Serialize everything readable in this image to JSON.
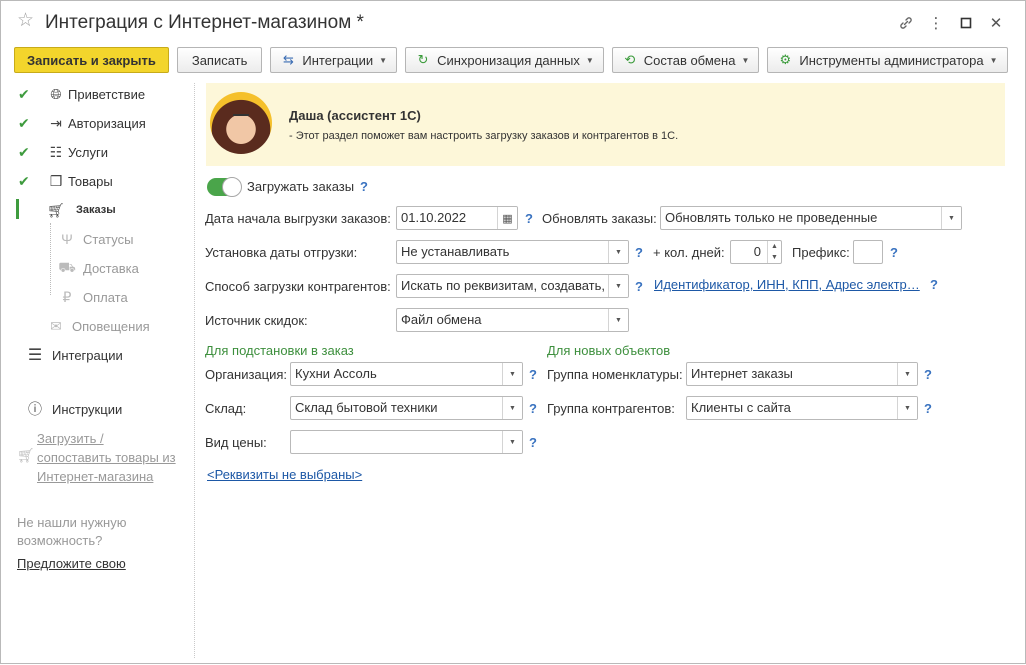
{
  "window": {
    "title": "Интеграция с Интернет-магазином *",
    "icons": [
      "link-icon",
      "more-icon",
      "maximize-icon",
      "close-icon"
    ]
  },
  "toolbar": {
    "save_close": "Записать и закрыть",
    "save": "Записать",
    "integrations": "Интеграции",
    "sync": "Синхронизация данных",
    "exchange": "Состав обмена",
    "admin_tools": "Инструменты администратора"
  },
  "sidebar": {
    "items": [
      {
        "label": "Приветствие",
        "done": true
      },
      {
        "label": "Авторизация",
        "done": true
      },
      {
        "label": "Услуги",
        "done": true
      },
      {
        "label": "Товары",
        "done": true
      },
      {
        "label": "Заказы",
        "active": true
      },
      {
        "label": "Статусы"
      },
      {
        "label": "Доставка"
      },
      {
        "label": "Оплата"
      },
      {
        "label": "Оповещения"
      },
      {
        "label": "Интеграции"
      }
    ],
    "instructions": "Инструкции",
    "upload_link_1": "Загрузить /",
    "upload_link_2": "сопоставить товары из",
    "upload_link_3": "Интернет-магазина",
    "not_found_1": "Не нашли нужную",
    "not_found_2": "возможность?",
    "suggest": "Предложите свою"
  },
  "assistant": {
    "name": "Даша (ассистент 1С)",
    "text": "- Этот раздел поможет вам настроить загрузку заказов и контрагентов в 1С."
  },
  "form": {
    "load_orders_label": "Загружать заказы",
    "load_orders_on": true,
    "start_date_label": "Дата начала выгрузки заказов:",
    "start_date_value": "01.10.2022",
    "update_orders_label": "Обновлять заказы:",
    "update_orders_value": "Обновлять только не проведенные",
    "ship_date_label": "Установка даты отгрузки:",
    "ship_date_value": "Не устанавливать",
    "plus_days_label": "+ кол. дней:",
    "plus_days_value": "0",
    "prefix_label": "Префикс:",
    "prefix_value": "",
    "contractor_label": "Способ загрузки контрагентов:",
    "contractor_value": "Искать по реквизитам, создавать,",
    "contractor_link": "Идентификатор, ИНН, КПП, Адрес электр…",
    "discount_label": "Источник скидок:",
    "discount_value": "Файл обмена",
    "subst_title": "Для подстановки в заказ",
    "new_obj_title": "Для новых объектов",
    "org_label": "Организация:",
    "org_value": "Кухни Ассоль",
    "warehouse_label": "Склад:",
    "warehouse_value": "Склад бытовой техники",
    "price_label": "Вид цены:",
    "price_value": "",
    "nom_group_label": "Группа номенклатуры:",
    "nom_group_value": "Интернет заказы",
    "cont_group_label": "Группа контрагентов:",
    "cont_group_value": "Клиенты с сайта",
    "details_link": "<Реквизиты не выбраны>",
    "help": "?"
  }
}
